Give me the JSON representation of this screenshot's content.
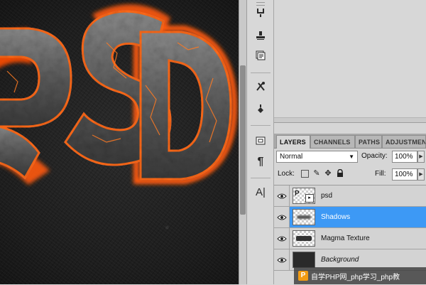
{
  "canvas": {
    "artwork_text": "SD"
  },
  "layers_panel": {
    "tabs": [
      {
        "label": "LAYERS",
        "active": true
      },
      {
        "label": "CHANNELS",
        "active": false
      },
      {
        "label": "PATHS",
        "active": false
      },
      {
        "label": "ADJUSTMEN",
        "active": false
      }
    ],
    "blend_mode": "Normal",
    "opacity_label": "Opacity:",
    "opacity_value": "100%",
    "lock_label": "Lock:",
    "fill_label": "Fill:",
    "fill_value": "100%",
    "layers": [
      {
        "name": "psd",
        "selected": false,
        "thumb": "text-layer"
      },
      {
        "name": "Shadows",
        "selected": true,
        "thumb": "transparent"
      },
      {
        "name": "Magma Texture",
        "selected": false,
        "thumb": "transparent"
      },
      {
        "name": "Background",
        "selected": false,
        "thumb": "dark"
      }
    ]
  },
  "tool_icons": [
    "clone-source-icon",
    "stamp-icon",
    "layer-comps-icon",
    "brushes-icon",
    "tool-presets-icon",
    "navigator-icon",
    "paragraph-icon",
    "character-icon"
  ],
  "watermark": {
    "text": "自学PHP网_php学习_php教"
  },
  "colors": {
    "selection": "#3d99f5",
    "panel": "#d6d6d6",
    "lava": "#ff6a1a"
  }
}
